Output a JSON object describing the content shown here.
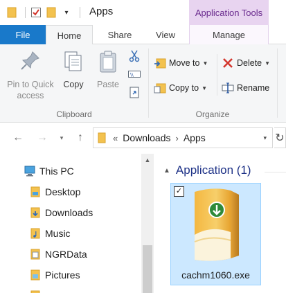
{
  "window": {
    "title": "Apps"
  },
  "context_tab_group": "Application Tools",
  "tabs": [
    {
      "label": "File"
    },
    {
      "label": "Home"
    },
    {
      "label": "Share"
    },
    {
      "label": "View"
    },
    {
      "label": "Manage"
    }
  ],
  "ribbon": {
    "clipboard": {
      "group_label": "Clipboard",
      "pin_label_1": "Pin to Quick",
      "pin_label_2": "access",
      "copy_label": "Copy",
      "paste_label": "Paste"
    },
    "organize": {
      "group_label": "Organize",
      "move_to_label": "Move to",
      "copy_to_label": "Copy to",
      "delete_label": "Delete",
      "rename_label": "Rename"
    }
  },
  "address": {
    "overflow": "«",
    "crumbs": [
      "Downloads",
      "Apps"
    ]
  },
  "nav_pane": {
    "items": [
      {
        "label": "This PC",
        "icon": "computer-icon"
      },
      {
        "label": "Desktop",
        "icon": "desktop-folder-icon"
      },
      {
        "label": "Downloads",
        "icon": "downloads-folder-icon"
      },
      {
        "label": "Music",
        "icon": "music-folder-icon"
      },
      {
        "label": "NGRData",
        "icon": "document-icon"
      },
      {
        "label": "Pictures",
        "icon": "pictures-folder-icon"
      }
    ]
  },
  "content": {
    "group_header": "Application (1)",
    "files": [
      {
        "name": "cachm1060.exe",
        "selected": true,
        "icon": "installer-box-icon"
      }
    ]
  },
  "colors": {
    "file_tab": "#1979ca",
    "context_tab": "#e8d4f0",
    "selection": "#cce8ff",
    "group_header": "#1e3287"
  }
}
